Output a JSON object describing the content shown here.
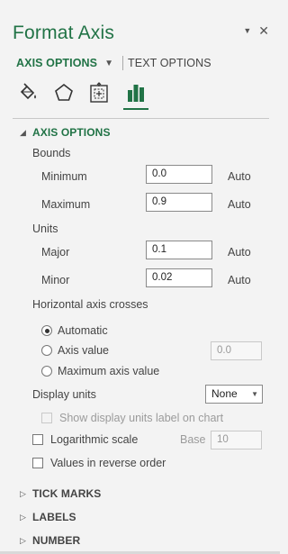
{
  "pane": {
    "title": "Format Axis",
    "pin_glyph": "▼",
    "close_glyph": "✕"
  },
  "tabs": {
    "axis_options": "AXIS OPTIONS",
    "text_options": "TEXT OPTIONS"
  },
  "icons": [
    "fill-line-icon",
    "effects-icon",
    "size-properties-icon",
    "axis-options-icon"
  ],
  "axis_options_section": {
    "title": "AXIS OPTIONS",
    "bounds_label": "Bounds",
    "minimum_label": "Minimum",
    "minimum_value": "0.0",
    "minimum_auto": "Auto",
    "maximum_label": "Maximum",
    "maximum_value": "0.9",
    "maximum_auto": "Auto",
    "units_label": "Units",
    "major_label": "Major",
    "major_value": "0.1",
    "major_auto": "Auto",
    "minor_label": "Minor",
    "minor_value": "0.02",
    "minor_auto": "Auto",
    "crosses_label": "Horizontal axis crosses",
    "crosses_options": [
      "Automatic",
      "Axis value",
      "Maximum axis value"
    ],
    "crosses_selected": "Automatic",
    "axis_value": "0.0",
    "display_units_label": "Display units",
    "display_units_value": "None",
    "show_units_label": "Show display units label on chart",
    "log_scale_label": "Logarithmic scale",
    "base_label": "Base",
    "base_value": "10",
    "reverse_label": "Values in reverse order"
  },
  "collapsed_sections": [
    "TICK MARKS",
    "LABELS",
    "NUMBER"
  ],
  "colors": {
    "accent": "#217346",
    "background": "#f3f3f3"
  }
}
